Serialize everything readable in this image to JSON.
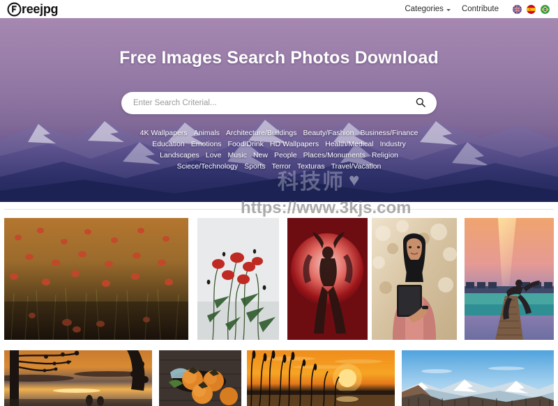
{
  "navbar": {
    "brand": "reejpg",
    "brand_icon": "circled-f-logo",
    "links": [
      {
        "label": "Categories",
        "has_caret": true
      },
      {
        "label": "Contribute",
        "has_caret": false
      }
    ],
    "flags": [
      {
        "name": "flag-uk",
        "title": "English"
      },
      {
        "name": "flag-spain",
        "title": "Espanol"
      },
      {
        "name": "flag-brazil",
        "title": "Portugues"
      }
    ]
  },
  "hero": {
    "title": "Free Images Search Photos Download",
    "search": {
      "placeholder": "Enter Search Criterial...",
      "value": "",
      "icon": "search-icon"
    },
    "categories": [
      "4K Wallpapers",
      "Animals",
      "Architecture/Buildings",
      "Beauty/Fashion",
      "Business/Finance",
      "Education",
      "Emotions",
      "Food/Drink",
      "HD Wallpapers",
      "Health/Medical",
      "Industry",
      "Landscapes",
      "Love",
      "Music",
      "New",
      "People",
      "Places/Monuments",
      "Religion",
      "Sciece/Technology",
      "Sports",
      "Terror",
      "Texturas",
      "Travel/Vacation"
    ]
  },
  "watermark": {
    "logo_text": "科技师",
    "heart": "♥",
    "url": "https://www.3kjs.com"
  },
  "gallery": {
    "rows": [
      {
        "items": [
          {
            "name": "photo-poppy-field",
            "alt": "Red poppy field at dusk"
          },
          {
            "name": "photo-poppies-sky",
            "alt": "Poppies against pale sky"
          },
          {
            "name": "photo-dancer-red",
            "alt": "Dancer on red backdrop"
          },
          {
            "name": "photo-woman-tablet",
            "alt": "Smiling woman in pink coat holding tablet"
          },
          {
            "name": "photo-pier-rainbow",
            "alt": "Person dancing on pier under rainbow"
          }
        ]
      },
      {
        "items": [
          {
            "name": "photo-sunset-tree",
            "alt": "Sunset over water with tree silhouette"
          },
          {
            "name": "photo-persimmons",
            "alt": "Persimmons in bowl on dark wood"
          },
          {
            "name": "photo-sunset-reeds",
            "alt": "Orange sunset behind reeds"
          },
          {
            "name": "photo-mountains-blue",
            "alt": "Snowy mountain range under blue sky"
          }
        ]
      }
    ]
  },
  "colors": {
    "hero_top": "#a98bb3",
    "hero_bottom": "#232a5c",
    "page_bg": "#ffffff",
    "text_dark": "#2b2b2b"
  }
}
